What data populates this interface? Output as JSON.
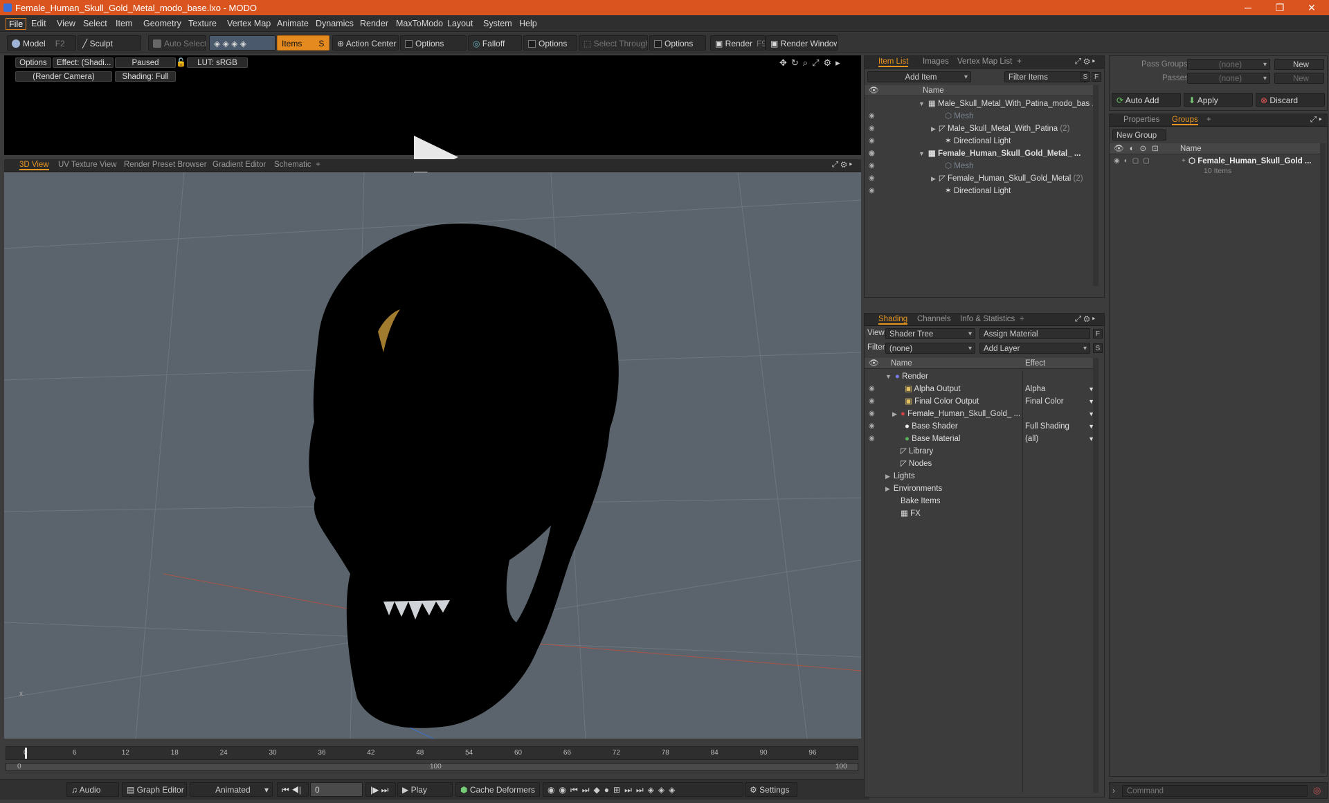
{
  "window": {
    "title": "Female_Human_Skull_Gold_Metal_modo_base.lxo - MODO",
    "minimize": "─",
    "maximize": "❐",
    "close": "✕"
  },
  "menu": [
    "File",
    "Edit",
    "View",
    "Select",
    "Item",
    "Geometry",
    "Texture",
    "Vertex Map",
    "Animate",
    "Dynamics",
    "Render",
    "MaxToModo",
    "Layout",
    "System",
    "Help"
  ],
  "toolbar": {
    "model": "Model",
    "model_key": "F2",
    "sculpt": "Sculpt",
    "auto_select": "Auto Select",
    "items": "Items",
    "items_key": "S",
    "action_center": "Action Center",
    "options1": "Options",
    "falloff": "Falloff",
    "options2": "Options",
    "select_through": "Select Through",
    "options3": "Options",
    "render": "Render",
    "render_key": "F9",
    "render_window": "Render Window"
  },
  "preview": {
    "options": "Options",
    "effect": "Effect: (Shadi...",
    "paused": "Paused",
    "lut": "LUT: sRGB",
    "camera": "(Render Camera)",
    "shading": "Shading: Full"
  },
  "viewtabs": [
    "3D View",
    "UV Texture View",
    "Render Preset Browser",
    "Gradient Editor",
    "Schematic",
    "+"
  ],
  "timeline": {
    "ticks": [
      "0",
      "6",
      "12",
      "18",
      "24",
      "30",
      "36",
      "42",
      "48",
      "54",
      "60",
      "66",
      "72",
      "78",
      "84",
      "90",
      "96"
    ],
    "range_start": "0",
    "range_mid": "100",
    "range_end": "100"
  },
  "bottom": {
    "audio": "Audio",
    "graph_editor": "Graph Editor",
    "animated": "Animated",
    "frame": "0",
    "play": "Play",
    "cache": "Cache Deformers",
    "settings": "Settings"
  },
  "itemlist": {
    "tabs": [
      "Item List",
      "Images",
      "Vertex Map List",
      "+"
    ],
    "add_item": "Add Item",
    "filter": "Filter Items",
    "s": "S",
    "f": "F",
    "col_name": "Name",
    "rows": [
      {
        "label": "Male_Skull_Metal_With_Patina_modo_bas ...",
        "count": "",
        "dim": false
      },
      {
        "label": "Mesh",
        "count": "",
        "dim": true
      },
      {
        "label": "Male_Skull_Metal_With_Patina",
        "count": "(2)",
        "dim": false
      },
      {
        "label": "Directional Light",
        "count": "",
        "dim": false
      },
      {
        "label": "Female_Human_Skull_Gold_Metal_ ...",
        "count": "",
        "dim": false
      },
      {
        "label": "Mesh",
        "count": "",
        "dim": true
      },
      {
        "label": "Female_Human_Skull_Gold_Metal",
        "count": "(2)",
        "dim": false
      },
      {
        "label": "Directional Light",
        "count": "",
        "dim": false
      }
    ]
  },
  "shading": {
    "tabs": [
      "Shading",
      "Channels",
      "Info & Statistics",
      "+"
    ],
    "view_label": "View",
    "view_value": "Shader Tree",
    "assign": "Assign Material",
    "f": "F",
    "filter_label": "Filter",
    "filter_value": "(none)",
    "add_layer": "Add Layer",
    "s": "S",
    "col_name": "Name",
    "col_effect": "Effect",
    "rows": [
      {
        "label": "Render",
        "effect": ""
      },
      {
        "label": "Alpha Output",
        "effect": "Alpha"
      },
      {
        "label": "Final Color Output",
        "effect": "Final Color"
      },
      {
        "label": "Female_Human_Skull_Gold_ ...",
        "effect": ""
      },
      {
        "label": "Base Shader",
        "effect": "Full Shading"
      },
      {
        "label": "Base Material",
        "effect": "(all)"
      },
      {
        "label": "Library",
        "effect": ""
      },
      {
        "label": "Nodes",
        "effect": ""
      },
      {
        "label": "Lights",
        "effect": ""
      },
      {
        "label": "Environments",
        "effect": ""
      },
      {
        "label": "Bake Items",
        "effect": ""
      },
      {
        "label": "FX",
        "effect": ""
      }
    ]
  },
  "passes": {
    "pass_groups_label": "Pass Groups",
    "pass_groups_value": "(none)",
    "new1": "New",
    "passes_label": "Passes",
    "passes_value": "(none)",
    "new2": "New",
    "auto_add": "Auto Add",
    "apply": "Apply",
    "discard": "Discard"
  },
  "groups": {
    "tabs": [
      "Properties",
      "Groups",
      "+"
    ],
    "new_group": "New Group",
    "col_name": "Name",
    "group_name": "Female_Human_Skull_Gold ...",
    "group_items": "10 Items"
  },
  "command": {
    "placeholder": "Command"
  },
  "colors": {
    "accent": "#e8951f",
    "title": "#d9541e",
    "viewport": "#5b646d"
  }
}
